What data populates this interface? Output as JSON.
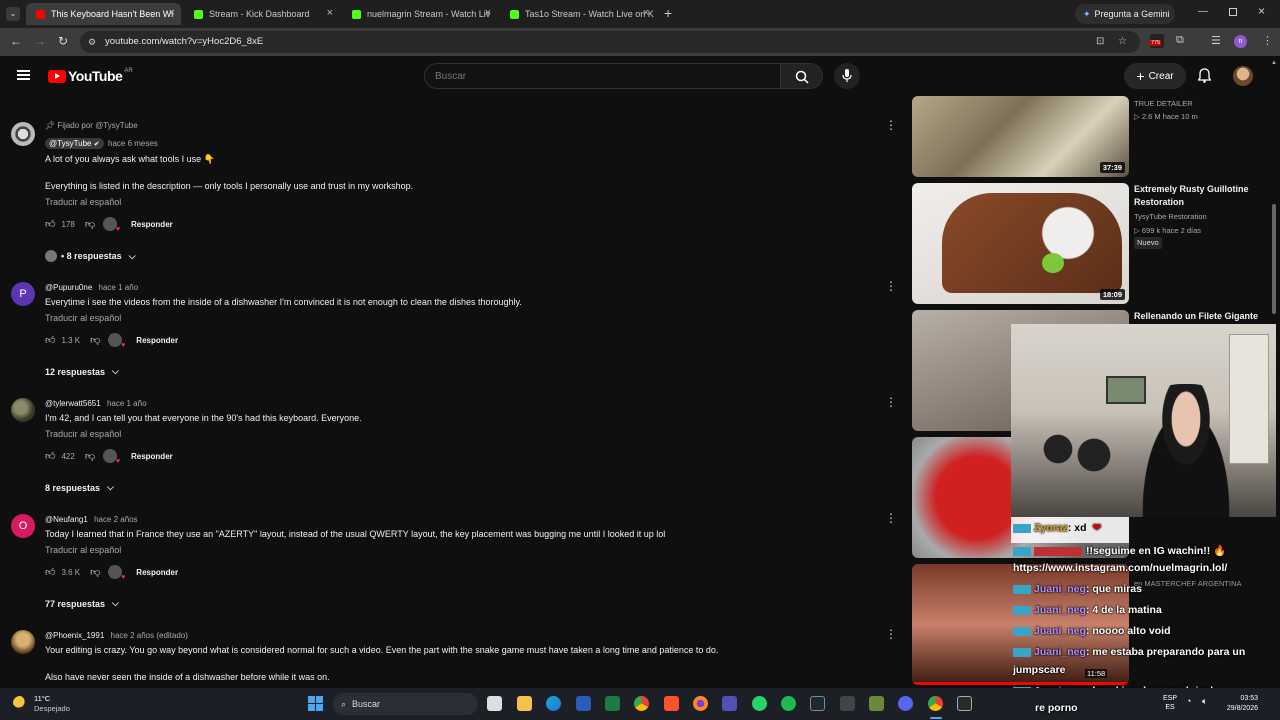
{
  "browser": {
    "tabs": [
      {
        "label": "This Keyboard Hasn't Been Wi",
        "color": "#ff0000"
      },
      {
        "label": "Stream - Kick Dashboard",
        "color": "#53fc18"
      },
      {
        "label": "nuelmagrin Stream - Watch Liv",
        "color": "#53fc18"
      },
      {
        "label": "Tas1o Stream - Watch Live on K",
        "color": "#53fc18"
      }
    ],
    "gemini_label": "Pregunta a Gemini",
    "url": "youtube.com/watch?v=yHoc2D6_8xE",
    "ext_badge": "775"
  },
  "youtube": {
    "logo_text": "YouTube",
    "region": "AR",
    "search_placeholder": "Buscar",
    "create_label": "Crear"
  },
  "comments": [
    {
      "pinned": "Fijado por @TysyTube",
      "handle": "@TysyTube",
      "time": "hace 6 meses",
      "lines": [
        "A lot of you always ask what tools I use 👇",
        "",
        "Everything is listed in the description — only tools I personally use and trust in my workshop."
      ],
      "translate": "Traducir al español",
      "likes": "178",
      "reply_label": "Responder",
      "replies": "• 8 respuestas"
    },
    {
      "avatar_letter": "P",
      "avatar_color": "#5e35b1",
      "handle": "@Pupuru0ne",
      "time": "hace 1 año",
      "lines": [
        "Everytime i see the videos from the inside of a dishwasher I'm convinced it is not enough to clean the dishes thoroughly."
      ],
      "translate": "Traducir al español",
      "likes": "1.3 K",
      "reply_label": "Responder",
      "replies": "12 respuestas"
    },
    {
      "handle": "@tylerwatt5651",
      "time": "hace 1 año",
      "lines": [
        "I'm 42, and I can tell you that everyone in the 90's had this keyboard. Everyone."
      ],
      "translate": "Traducir al español",
      "likes": "422",
      "reply_label": "Responder",
      "replies": "8 respuestas"
    },
    {
      "avatar_letter": "O",
      "avatar_color": "#d81b60",
      "handle": "@Neufang1",
      "time": "hace 2 años",
      "lines": [
        "Today I learned that in France they use an \"AZERTY\" layout, instead of the usual QWERTY layout, the key placement was bugging me until I looked it up lol"
      ],
      "translate": "Traducir al español",
      "likes": "3.6 K",
      "reply_label": "Responder",
      "replies": "77 respuestas"
    },
    {
      "handle": "@Phoenix_1991",
      "time": "hace 2 años (editado)",
      "lines": [
        "Your editing is crazy. You go way beyond what is considered normal for such a video. Even the part with the snake game must have taken a long time and patience to do.",
        "",
        "Also have never seen the inside of a dishwasher before while it was on."
      ]
    }
  ],
  "sidebar_videos": [
    {
      "title": "",
      "channel": "TRUE DETAILER",
      "meta": "▷ 2.6 M  hace 10 m",
      "duration": "37:39"
    },
    {
      "title": "Extremely Rusty Guillotine Restoration",
      "channel": "TysyTube Restoration",
      "meta": "▷ 699 k  hace 2 días",
      "badge": "Nuevo",
      "duration": "18:09"
    },
    {
      "title": "Rellenando un Filete Gigante",
      "channel": "",
      "meta": ""
    },
    {
      "title": "",
      "channel": "",
      "meta": ""
    },
    {
      "title": "",
      "channel": "en MASTERCHEF ARGENTINA",
      "meta": ""
    }
  ],
  "chat": [
    {
      "user": "Zyoraz",
      "msg": ": xd"
    },
    {
      "user": "",
      "msg": "!!seguime en IG wachin!! 🔥"
    },
    {
      "user": "",
      "msg": "https://www.instagram.com/nuelmagrin.lol/"
    },
    {
      "user": "Juani_neg",
      "msg": ":  que miras"
    },
    {
      "user": "Juani_neg",
      "msg": ": 4 de la matina"
    },
    {
      "user": "Juani_neg",
      "msg": ": noooo   alto void"
    },
    {
      "user": "Juani_neg",
      "msg": ": me estaba preparando para un"
    },
    {
      "user": "",
      "msg": "jumpscare"
    },
    {
      "user": "Juani_neg",
      "msg": ":  las skins de marvel rivals"
    },
    {
      "user": "",
      "msg": "re porno"
    }
  ],
  "video_time": "11:58",
  "taskbar": {
    "temp": "11°C",
    "weather": "Despejado",
    "search": "Buscar",
    "lang": "ESP",
    "lang2": "ES",
    "clock": "03:53",
    "date": "29/8/2026"
  }
}
